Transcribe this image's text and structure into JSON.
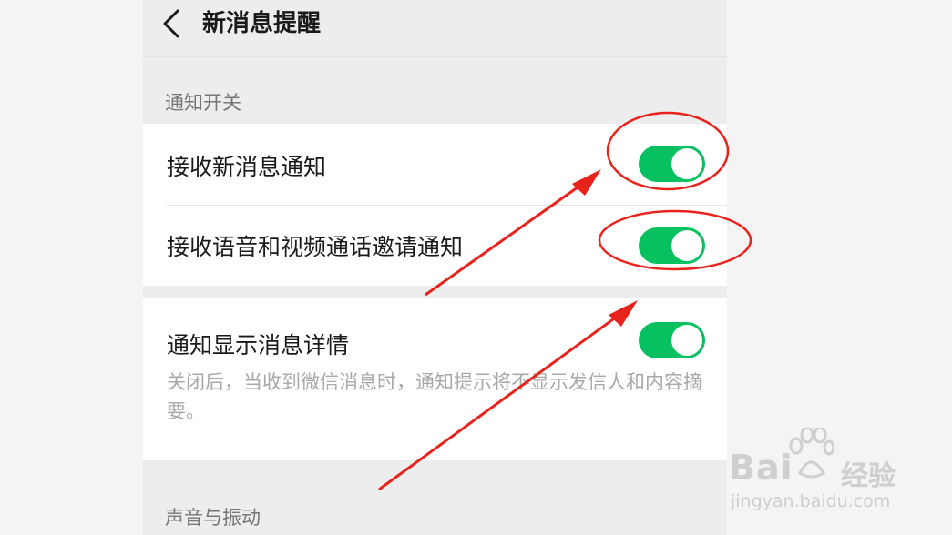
{
  "header": {
    "title": "新消息提醒"
  },
  "sections": [
    {
      "label": "通知开关"
    },
    {
      "label": "声音与振动"
    }
  ],
  "rows": [
    {
      "label": "接收新消息通知",
      "enabled": true
    },
    {
      "label": "接收语音和视频通话邀请通知",
      "enabled": true
    },
    {
      "label": "通知显示消息详情",
      "enabled": true,
      "description": "关闭后，当收到微信消息时，通知提示将不显示发信人和内容摘要。"
    }
  ],
  "colors": {
    "toggle_on": "#07c160",
    "annotation": "#e8231c",
    "background": "#ededed"
  },
  "watermark": {
    "brand": "Bai",
    "brand_suffix": "经验",
    "url": "jingyan.baidu.com"
  }
}
